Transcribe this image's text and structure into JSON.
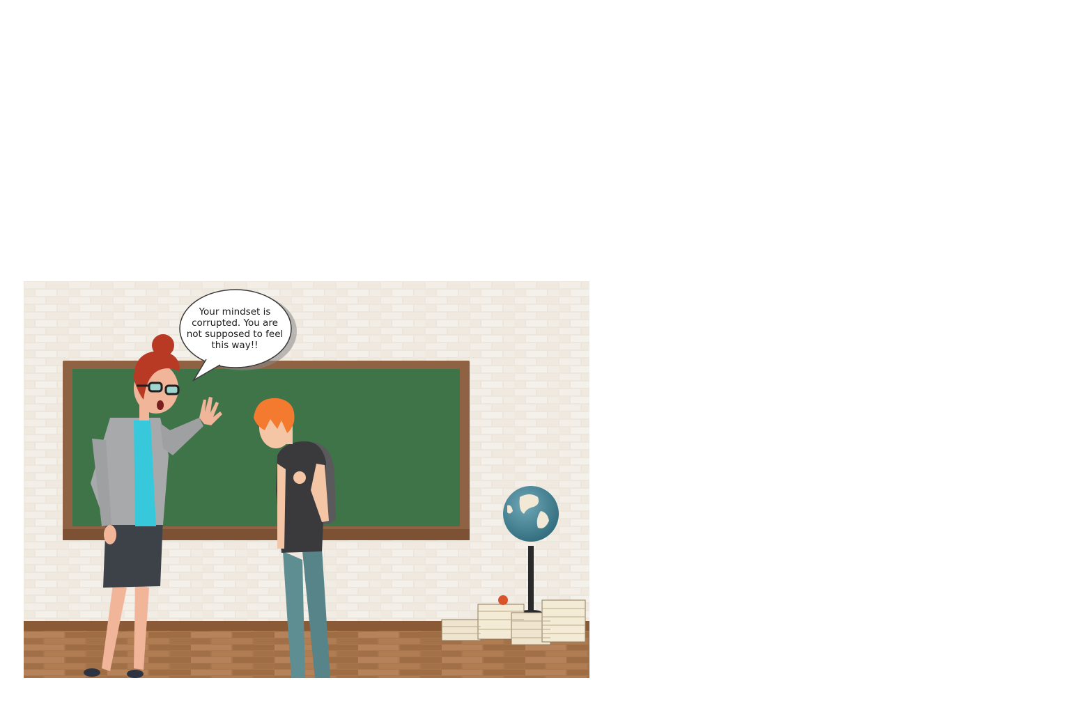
{
  "scene": {
    "speech_bubble": {
      "text": "Your mindset is corrupted. You are not supposed to feel this way!!"
    },
    "icons": [
      "teacher-figure",
      "student-figure",
      "chalkboard",
      "globe",
      "book-stacks",
      "apple"
    ]
  }
}
